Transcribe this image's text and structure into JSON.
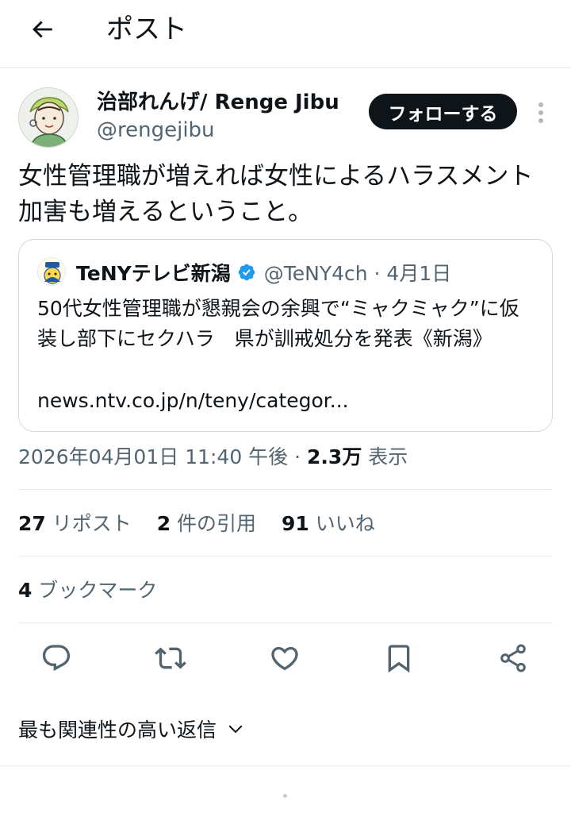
{
  "header": {
    "title": "ポスト"
  },
  "author": {
    "display_name": "治部れんげ/ Renge Jibu",
    "handle": "@rengejibu",
    "follow_label": "フォローする"
  },
  "tweet": {
    "text": "女性管理職が増えれば女性によるハラスメント加害も増えるということ。"
  },
  "quote": {
    "name": "TeNYテレビ新潟",
    "meta": "@TeNY4ch · 4月1日",
    "text": "50代女性管理職が懇親会の余興で“ミャクミャク”に仮装し部下にセクハラ　県が訓戒処分を発表《新潟》",
    "link": "news.ntv.co.jp/n/teny/categor..."
  },
  "timestamp": {
    "datetime": "2026年04月01日 11:40 午後",
    "separator": " · ",
    "views_count": "2.3万",
    "views_label": " 表示"
  },
  "stats": {
    "reposts_count": "27",
    "reposts_label": " リポスト",
    "quotes_count": "2",
    "quotes_label": " 件の引用",
    "likes_count": "91",
    "likes_label": " いいね"
  },
  "bookmarks": {
    "count": "4",
    "label": " ブックマーク"
  },
  "actions": [
    "reply-icon",
    "repost-icon",
    "like-icon",
    "bookmark-icon",
    "share-icon"
  ],
  "replies_sort": {
    "label": "最も関連性の高い返信"
  },
  "colors": {
    "text_primary": "#0f1419",
    "text_secondary": "#536471",
    "border": "#cfd9de",
    "verified": "#1d9bf0",
    "follow_bg": "#0f1419"
  }
}
